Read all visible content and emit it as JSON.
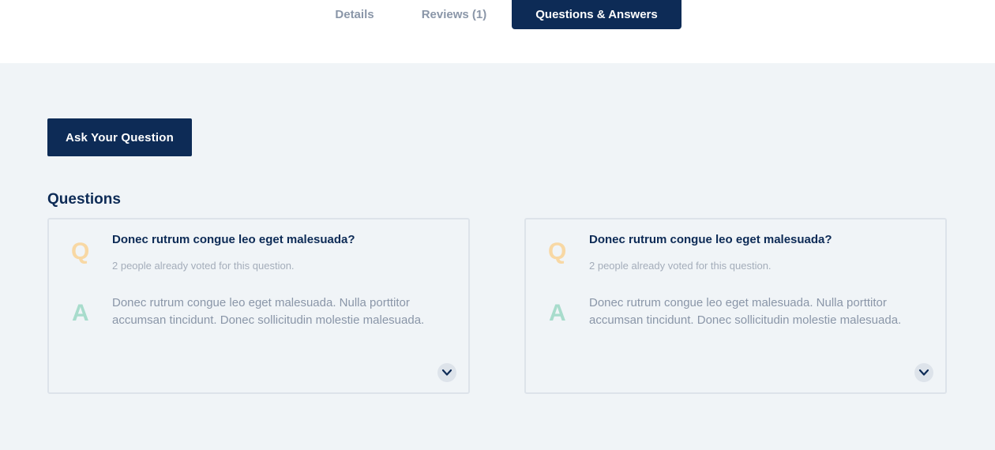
{
  "tabs": [
    {
      "label": "Details",
      "active": false
    },
    {
      "label": "Reviews (1)",
      "active": false
    },
    {
      "label": "Questions & Answers",
      "active": true
    }
  ],
  "ask_button_label": "Ask Your Question",
  "section_title": "Questions",
  "questions": [
    {
      "q_letter": "Q",
      "a_letter": "A",
      "question": "Donec rutrum congue leo eget malesuada?",
      "votes": "2 people already voted for this question.",
      "answer": "Donec rutrum congue leo eget malesuada. Nulla porttitor accumsan tincidunt. Donec sollicitudin molestie malesuada.",
      "toggle_icon": "chevron-down-icon"
    },
    {
      "q_letter": "Q",
      "a_letter": "A",
      "question": "Donec rutrum congue leo eget malesuada?",
      "votes": "2 people already voted for this question.",
      "answer": "Donec rutrum congue leo eget malesuada. Nulla porttitor accumsan tincidunt. Donec sollicitudin molestie malesuada.",
      "toggle_icon": "chevron-down-icon"
    }
  ],
  "colors": {
    "primary": "#0d2b56",
    "panel_bg": "#f0f4f7",
    "q_accent": "#f8d8a4",
    "a_accent": "#a8dccc",
    "muted_text": "#8a96a8"
  }
}
